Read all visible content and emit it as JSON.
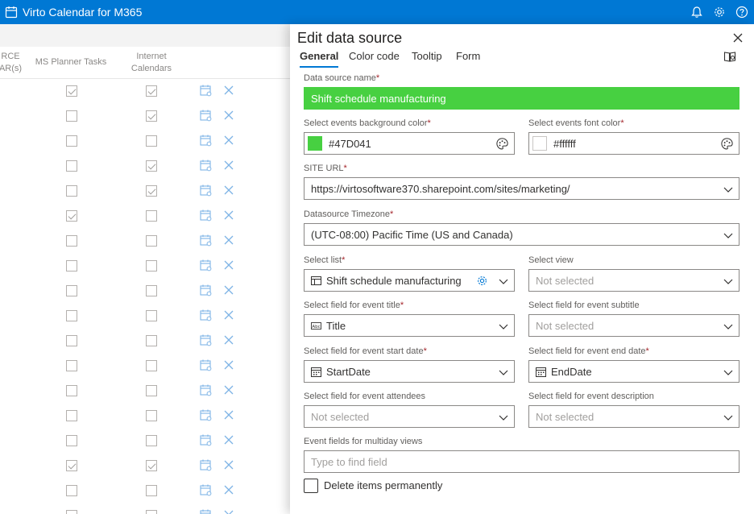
{
  "app": {
    "title": "Virto Calendar for M365"
  },
  "background": {
    "columns": [
      "RCE",
      "AR(s)",
      "MS Planner Tasks",
      "Internet",
      "Calendars"
    ],
    "rows": [
      {
        "planner": true,
        "internet": true
      },
      {
        "planner": false,
        "internet": true
      },
      {
        "planner": false,
        "internet": false
      },
      {
        "planner": false,
        "internet": true
      },
      {
        "planner": false,
        "internet": true
      },
      {
        "planner": true,
        "internet": false
      },
      {
        "planner": false,
        "internet": false
      },
      {
        "planner": false,
        "internet": false
      },
      {
        "planner": false,
        "internet": false
      },
      {
        "planner": false,
        "internet": false
      },
      {
        "planner": false,
        "internet": false
      },
      {
        "planner": false,
        "internet": false
      },
      {
        "planner": false,
        "internet": false
      },
      {
        "planner": false,
        "internet": false
      },
      {
        "planner": false,
        "internet": false
      },
      {
        "planner": true,
        "internet": true
      },
      {
        "planner": false,
        "internet": false
      },
      {
        "planner": false,
        "internet": false
      }
    ]
  },
  "panel": {
    "title": "Edit data source",
    "tabs": [
      "General",
      "Color code",
      "Tooltip",
      "Form"
    ],
    "active_tab": "General",
    "fields": {
      "name_label": "Data source name",
      "name_value": "Shift schedule manufacturing",
      "bg_color_label": "Select events background color",
      "bg_color_value": "#47D041",
      "font_color_label": "Select events font color",
      "font_color_value": "#ffffff",
      "site_url_label": "SITE URL",
      "site_url_value": "https://virtosoftware370.sharepoint.com/sites/marketing/",
      "timezone_label": "Datasource Timezone",
      "timezone_value": "(UTC-08:00) Pacific Time (US and Canada)",
      "list_label": "Select list",
      "list_value": "Shift schedule manufacturing",
      "view_label": "Select view",
      "view_placeholder": "Not selected",
      "title_field_label": "Select field for event title",
      "title_field_value": "Title",
      "subtitle_label": "Select field for event subtitle",
      "subtitle_placeholder": "Not selected",
      "start_label": "Select field for event start date",
      "start_value": "StartDate",
      "end_label": "Select field for event end date",
      "end_value": "EndDate",
      "attendees_label": "Select field for event attendees",
      "attendees_placeholder": "Not selected",
      "description_label": "Select field for event description",
      "description_placeholder": "Not selected",
      "multiday_label": "Event fields for multiday views",
      "multiday_placeholder": "Type to find field",
      "delete_label": "Delete items permanently"
    }
  },
  "colors": {
    "brand": "#0078d4",
    "accent_green": "#47D041",
    "required": "#a4262c"
  },
  "icons": [
    "calendar-app-icon",
    "bell-icon",
    "gear-icon",
    "help-icon",
    "close-icon",
    "book-icon",
    "palette-icon",
    "chevron-down-icon",
    "list-icon",
    "text-field-icon",
    "calendar-field-icon",
    "calendar-edit-icon",
    "delete-x-icon"
  ]
}
